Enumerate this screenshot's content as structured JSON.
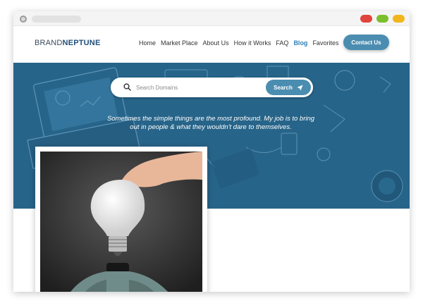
{
  "browser": {
    "traffic_lights": [
      {
        "name": "red",
        "color": "#e0443c"
      },
      {
        "name": "green",
        "color": "#7cbf2e"
      },
      {
        "name": "yellow",
        "color": "#f2b51b"
      }
    ]
  },
  "header": {
    "logo": {
      "part1": "BRAND",
      "part2": "NEPTUNE"
    },
    "menu": [
      {
        "label": "Home",
        "active": false
      },
      {
        "label": "Market Place",
        "active": false
      },
      {
        "label": "About Us",
        "active": false
      },
      {
        "label": "How it Works",
        "active": false
      },
      {
        "label": "FAQ",
        "active": false
      },
      {
        "label": "Blog",
        "active": true
      },
      {
        "label": "Favorites",
        "active": false
      }
    ],
    "contact_label": "Contact Us"
  },
  "hero": {
    "search": {
      "placeholder": "Search Domains",
      "value": "",
      "button_label": "Search"
    },
    "quote_line1": "Sometimes the simple things are the most profound. My job is to bring",
    "quote_line2": "out in people & what they wouldn't dare to themselves."
  },
  "icons": {
    "search": "magnifier-icon",
    "send": "paper-plane-icon"
  },
  "colors": {
    "accent": "#4b8db0",
    "hero_tint": "#2b6c93",
    "active_link": "#2f7fb8",
    "logo_dark": "#1f4f7a"
  }
}
